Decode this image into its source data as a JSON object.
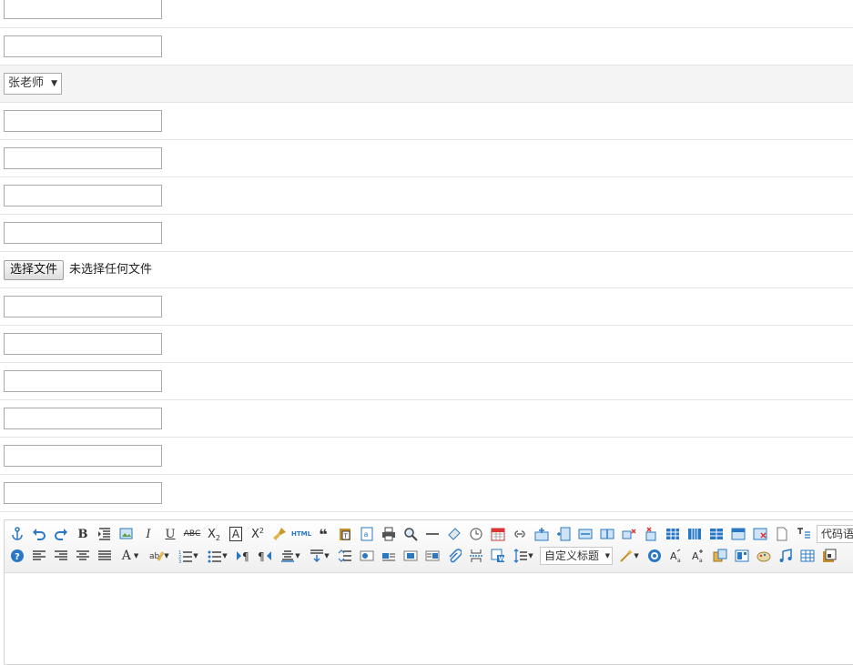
{
  "form": {
    "teacher_select": {
      "value": "张老师"
    },
    "file_button_label": "选择文件",
    "file_status": "未选择任何文件"
  },
  "editor": {
    "paragraph_dropdown": "自定义标题",
    "code_dropdown": "代码语",
    "toolbar_row1_icons": [
      "anchor-icon",
      "undo-icon",
      "redo-icon",
      "bold-icon",
      "indent-icon",
      "picture-edit-icon",
      "italic-icon",
      "underline-icon",
      "strikethrough-icon",
      "subscript-icon",
      "border-text-icon",
      "superscript-icon",
      "format-brush-icon",
      "html-icon",
      "quote-icon",
      "paste-plain-icon",
      "word-count-icon",
      "print-icon",
      "preview-icon",
      "horizontal-rule-icon",
      "eraser-icon",
      "time-icon",
      "date-icon",
      "link-icon",
      "table-insert-icon",
      "insert-col-icon",
      "merge-cells-icon",
      "split-cells-icon",
      "delete-col-icon",
      "delete-row-icon",
      "table-icon",
      "table-grid-icon",
      "table-cols-icon",
      "table-props-icon",
      "table-delete-icon",
      "new-page-icon",
      "text-direction-icon"
    ],
    "toolbar_row2_icons": [
      "help-icon",
      "align-left-icon",
      "align-right-icon",
      "align-center-icon",
      "justify-icon",
      "font-color-icon",
      "highlight-icon",
      "ordered-list-icon",
      "unordered-list-icon",
      "ltr-icon",
      "rtl-icon",
      "line-spacing-icon",
      "paragraph-spacing-icon",
      "row-spacing-icon",
      "image-left-icon",
      "image-none-icon",
      "image-center-icon",
      "image-right-icon",
      "attachment-icon",
      "page-break-icon",
      "word-image-icon",
      "line-height-icon",
      "magic-wand-icon",
      "emoticon-icon",
      "char-icon",
      "font-size-icon",
      "rich-media-icon",
      "template-icon",
      "background-icon",
      "music-icon",
      "chart-icon",
      "snapscreen-icon"
    ]
  }
}
